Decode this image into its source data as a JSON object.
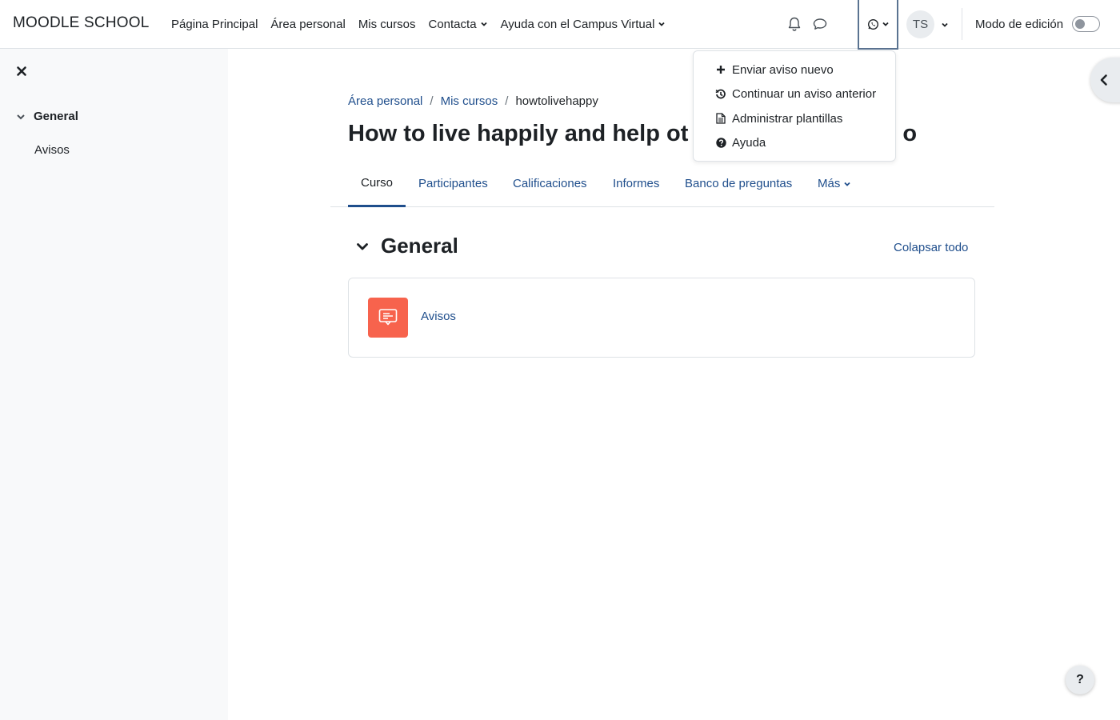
{
  "brand": "MOODLE SCHOOL",
  "primary_nav": [
    {
      "label": "Página Principal",
      "has_caret": false
    },
    {
      "label": "Área personal",
      "has_caret": false
    },
    {
      "label": "Mis cursos",
      "has_caret": false
    },
    {
      "label": "Contacta",
      "has_caret": true
    },
    {
      "label": "Ayuda con el Campus Virtual",
      "has_caret": true
    }
  ],
  "user": {
    "initials": "TS"
  },
  "edit_mode": {
    "label": "Modo de edición",
    "enabled": false
  },
  "drawer": {
    "section_label": "General",
    "items": [
      "Avisos"
    ]
  },
  "breadcrumb": {
    "items": [
      "Área personal",
      "Mis cursos"
    ],
    "current": "howtolivehappy"
  },
  "page_title": "How to live happily and help others ... achieve it too",
  "page_title_visible_start": "How to live happily and help ot",
  "page_title_visible_end": "o",
  "tabs": [
    "Curso",
    "Participantes",
    "Calificaciones",
    "Informes",
    "Banco de preguntas",
    "Más"
  ],
  "active_tab": "Curso",
  "section": {
    "title": "General",
    "collapse_all": "Colapsar todo"
  },
  "activities": [
    {
      "name": "Avisos",
      "icon": "forum-icon",
      "icon_color": "#f7634d"
    }
  ],
  "dropdown": {
    "items": [
      {
        "label": "Enviar aviso nuevo",
        "icon": "plus-icon"
      },
      {
        "label": "Continuar un aviso anterior",
        "icon": "history-icon"
      },
      {
        "label": "Administrar plantillas",
        "icon": "file-icon"
      },
      {
        "label": "Ayuda",
        "icon": "question-circle-icon"
      }
    ]
  },
  "help_button": "?",
  "colors": {
    "link": "#1f4e8c",
    "text": "#1d2125",
    "drawer_bg": "#f8f9fa",
    "activity_icon": "#f7634d",
    "focus_border": "#5a7391"
  }
}
